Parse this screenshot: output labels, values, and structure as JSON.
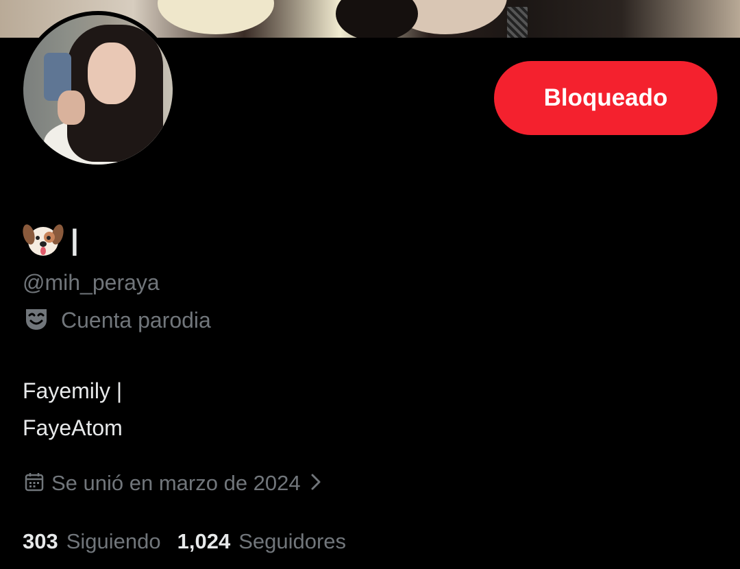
{
  "profile": {
    "name_separator": "|",
    "handle": "@mih_peraya",
    "parody_label": "Cuenta parodia",
    "bio_lines": [
      "Fayemily |",
      "FayeAtom"
    ],
    "joined": "Se unió en marzo de 2024",
    "following_count": "303",
    "following_label": "Siguiendo",
    "followers_count": "1,024",
    "followers_label": "Seguidores"
  },
  "actions": {
    "blocked_label": "Bloqueado"
  },
  "icons": {
    "name_emoji": "dog-face-icon",
    "parody": "theater-mask-icon",
    "joined": "calendar-icon",
    "joined_chevron": "chevron-right-icon"
  },
  "colors": {
    "background": "#000000",
    "blocked_button": "#f4212e",
    "primary_text": "#e7e9ea",
    "secondary_text": "#71767b"
  }
}
